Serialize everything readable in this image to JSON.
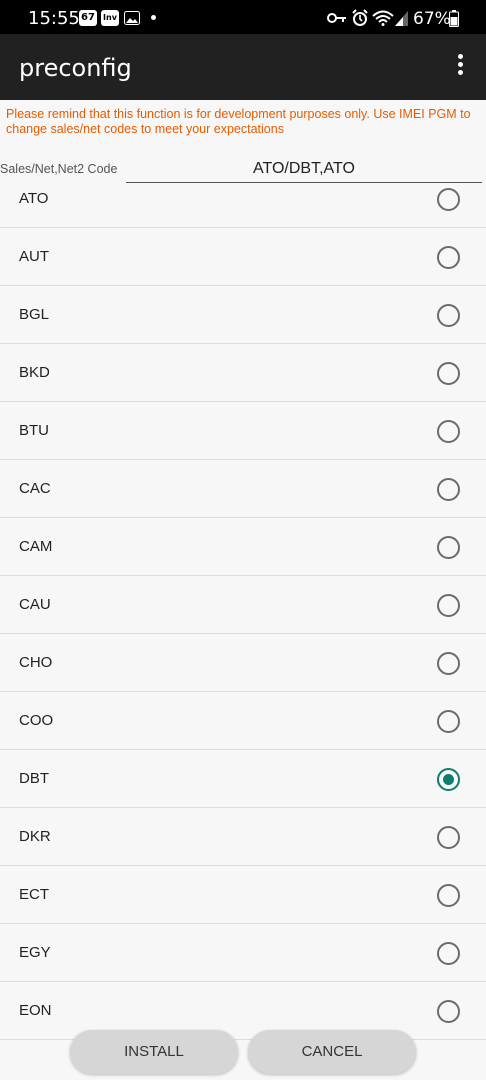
{
  "status_bar": {
    "time": "15:55",
    "notif_badge": "67",
    "notif_badge2": "Inv",
    "battery": "67%"
  },
  "app": {
    "title": "preconfig",
    "menu_icon": "more-vert-icon"
  },
  "warning": {
    "text": "Please remind that this function is for development purposes only. Use IMEI PGM to change sales/net codes to meet your expectations",
    "color": "#e65c00"
  },
  "code": {
    "label": "Sales/Net,Net2 Code",
    "value": "ATO/DBT,ATO"
  },
  "list": {
    "items": [
      {
        "label": "ATO",
        "selected": false
      },
      {
        "label": "AUT",
        "selected": false
      },
      {
        "label": "BGL",
        "selected": false
      },
      {
        "label": "BKD",
        "selected": false
      },
      {
        "label": "BTU",
        "selected": false
      },
      {
        "label": "CAC",
        "selected": false
      },
      {
        "label": "CAM",
        "selected": false
      },
      {
        "label": "CAU",
        "selected": false
      },
      {
        "label": "CHO",
        "selected": false
      },
      {
        "label": "COO",
        "selected": false
      },
      {
        "label": "DBT",
        "selected": true
      },
      {
        "label": "DKR",
        "selected": false
      },
      {
        "label": "ECT",
        "selected": false
      },
      {
        "label": "EGY",
        "selected": false
      },
      {
        "label": "EON",
        "selected": false
      }
    ],
    "accent": "#0f7c70"
  },
  "buttons": {
    "install": "INSTALL",
    "cancel": "CANCEL"
  }
}
